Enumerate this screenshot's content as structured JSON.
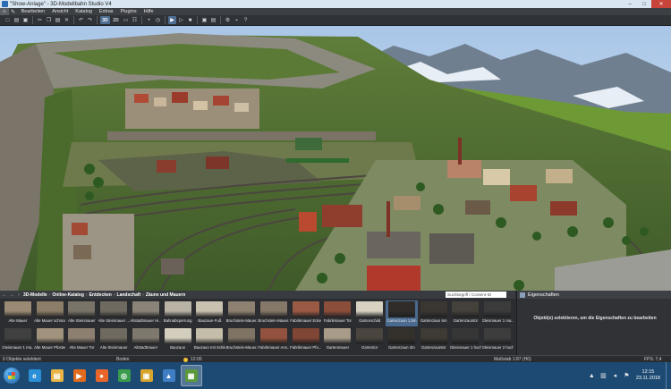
{
  "window": {
    "title": "\"Show-Anlage\" - 3D-Modellbahn Studio V4",
    "minimize": "–",
    "maximize": "□",
    "close": "✕"
  },
  "menu": {
    "home_icon": "house-icon",
    "items": [
      "Bearbeiten",
      "Ansicht",
      "Katalog",
      "Extras",
      "Plugins",
      "Hilfe"
    ]
  },
  "toolbar": {
    "buttons": [
      {
        "name": "new-icon",
        "glyph": "□"
      },
      {
        "name": "open-icon",
        "glyph": "▤"
      },
      {
        "name": "save-icon",
        "glyph": "▣"
      },
      {
        "name": "cut-icon",
        "glyph": "✂"
      },
      {
        "name": "copy-icon",
        "glyph": "❐"
      },
      {
        "name": "paste-icon",
        "glyph": "▤"
      },
      {
        "name": "delete-icon",
        "glyph": "✕"
      },
      {
        "name": "undo-icon",
        "glyph": "↶"
      },
      {
        "name": "redo-icon",
        "glyph": "↷"
      },
      {
        "name": "view-3d-button",
        "glyph": "3D",
        "active": true
      },
      {
        "name": "view-2d-button",
        "glyph": "2D"
      },
      {
        "name": "fit-icon",
        "glyph": "▭"
      },
      {
        "name": "grid-icon",
        "glyph": "☷"
      },
      {
        "name": "add-icon",
        "glyph": "+"
      },
      {
        "name": "clock-icon",
        "glyph": "◷"
      },
      {
        "name": "play-icon",
        "glyph": "▶",
        "active": true
      },
      {
        "name": "step-icon",
        "glyph": "▷"
      },
      {
        "name": "camera-icon",
        "glyph": "■"
      },
      {
        "name": "photo-icon",
        "glyph": "▣"
      },
      {
        "name": "bookmark-icon",
        "glyph": "▤"
      },
      {
        "name": "settings-icon",
        "glyph": "⚙"
      },
      {
        "name": "link-icon",
        "glyph": "⌁"
      },
      {
        "name": "help-icon",
        "glyph": "?"
      }
    ]
  },
  "catalog": {
    "nav": {
      "up": "↑",
      "back": "←",
      "forward": "→"
    },
    "breadcrumb": [
      "3D-Modelle",
      "Online-Katalog",
      "Entdecken",
      "Landschaft",
      "Zäune und Mauern"
    ],
    "search_placeholder": "Suchbegriff / Content-ID",
    "items": [
      {
        "label": "Alte Mauer",
        "color": "#9a8a74"
      },
      {
        "label": "Alte Mauer schmal",
        "color": "#8c7d68"
      },
      {
        "label": "Alte Steinmauer",
        "color": "#7a7468"
      },
      {
        "label": "Alte Steinmauer ...",
        "color": "#6e6a60"
      },
      {
        "label": "Altstadtmauer Hi...",
        "color": "#8a8478"
      },
      {
        "label": "Bahnabsperrung",
        "color": "#b9b3a6"
      },
      {
        "label": "Bauzaun-Fuß",
        "color": "#c9c2b0"
      },
      {
        "label": "Bruchstein-Mauer...",
        "color": "#8e8171"
      },
      {
        "label": "Bruchstein-Mauer...",
        "color": "#857868"
      },
      {
        "label": "Fabrikmauer Ecke",
        "color": "#9b5a43"
      },
      {
        "label": "Fabrikmauer Tor",
        "color": "#8a4e3a"
      },
      {
        "label": "Gartenschild",
        "color": "#d8d2c2"
      },
      {
        "label": "Gartenzaun 1,5m",
        "color": "#2f2c29",
        "selected": true
      },
      {
        "label": "Gartenzaun 6m",
        "color": "#3a3632"
      },
      {
        "label": "Gartenzauntür",
        "color": "#44403a"
      },
      {
        "label": "Gleismauer 1 ma...",
        "color": "#3b3b3b"
      },
      {
        "label": "Gleismauer 1 ma...",
        "color": "#404040"
      },
      {
        "label": "Alte Mauer Pfosten",
        "color": "#a0927c"
      },
      {
        "label": "Alte Mauer Tor",
        "color": "#8d8070"
      },
      {
        "label": "Alte Steinmauer",
        "color": "#6f6a5f"
      },
      {
        "label": "Altstadtmauer",
        "color": "#7e786d"
      },
      {
        "label": "Bauzaun",
        "color": "#d3cdbd"
      },
      {
        "label": "Bauzaun mit Schild",
        "color": "#c4bdaa"
      },
      {
        "label": "Bruchstein-Mauer...",
        "color": "#7f7364"
      },
      {
        "label": "Fabrikmauer Ans...",
        "color": "#93523d"
      },
      {
        "label": "Fabrikmauer Pfo...",
        "color": "#7f4535"
      },
      {
        "label": "Gartenmauer",
        "color": "#a89c88"
      },
      {
        "label": "Gartentor",
        "color": "#4a453e"
      },
      {
        "label": "Gartenzaun 3m",
        "color": "#34302b"
      },
      {
        "label": "Gartenzauntür",
        "color": "#3e3a34"
      },
      {
        "label": "Gleismauer 1 hoch",
        "color": "#363636"
      },
      {
        "label": "Gleismauer 2 hoch",
        "color": "#3d3d3d"
      },
      {
        "label": "Gleismauer 3 hoc...",
        "color": "#444444"
      }
    ]
  },
  "properties": {
    "header": "Eigenschaften",
    "message": "Objekt(e) selektieren, um die Eigenschaften zu bearbeiten"
  },
  "status": {
    "selection": "0 Objekte selektiert",
    "mode": "Boden",
    "time": "12:00",
    "scale": "Maßstab 1:87 (H0)",
    "fps": "FPS: 7,4"
  },
  "taskbar": {
    "apps": [
      {
        "name": "ie-icon",
        "glyph": "e",
        "color": "#2a8fd6"
      },
      {
        "name": "explorer-icon",
        "glyph": "▤",
        "color": "#e8b443"
      },
      {
        "name": "media-player-icon",
        "glyph": "▶",
        "color": "#e06b1f"
      },
      {
        "name": "firefox-icon",
        "glyph": "●",
        "color": "#e8662a"
      },
      {
        "name": "chrome-icon",
        "glyph": "◎",
        "color": "#3a9b4c"
      },
      {
        "name": "photo-app-icon",
        "glyph": "▣",
        "color": "#d8a52c"
      },
      {
        "name": "paint-icon",
        "glyph": "▲",
        "color": "#3f7ec4"
      },
      {
        "name": "modellbahn-icon",
        "glyph": "▦",
        "color": "#5b9a3b",
        "active": true
      }
    ],
    "clock_time": "12:15",
    "clock_date": "23.11.2018"
  }
}
